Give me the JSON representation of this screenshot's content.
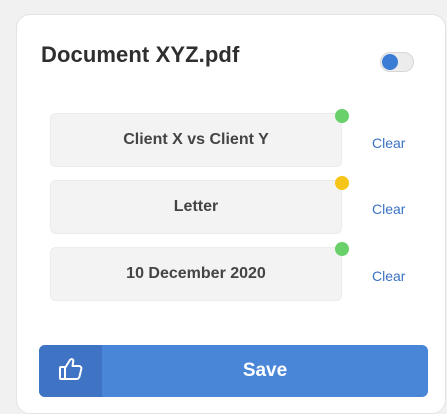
{
  "card": {
    "title": "Document XYZ.pdf",
    "toggle": {
      "on": false
    }
  },
  "fields": [
    {
      "value": "Client X vs Client Y",
      "status_color": "#6ad06a",
      "clear_label": "Clear"
    },
    {
      "value": "Letter",
      "status_color": "#f5c518",
      "clear_label": "Clear"
    },
    {
      "value": "10 December 2020",
      "status_color": "#6ad06a",
      "clear_label": "Clear"
    }
  ],
  "save": {
    "label": "Save",
    "icon": "thumbs-up-icon"
  },
  "colors": {
    "accent": "#4a86d8",
    "accent_dark": "#3f74c4",
    "link": "#3a73c4"
  }
}
